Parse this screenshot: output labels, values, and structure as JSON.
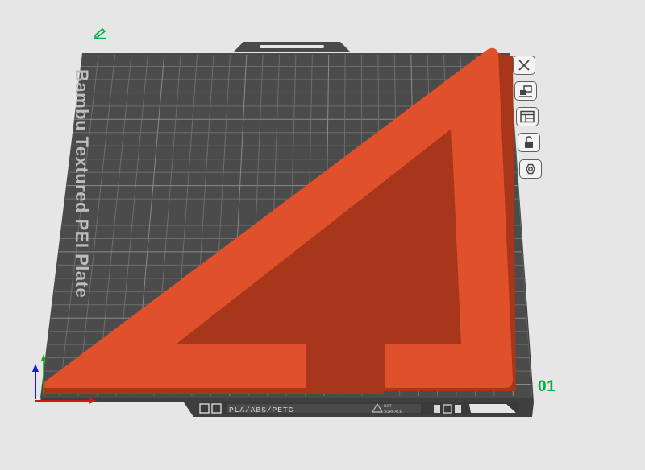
{
  "plate": {
    "name": "Bambu Textured PEI Plate",
    "number": "01",
    "filament_label": "PLA/ABS/PETG",
    "hot_surface_line1": "HOT",
    "hot_surface_line2": "SURFACE"
  },
  "colors": {
    "background": "#e6e6e6",
    "plate": "#4a4a4a",
    "model": "#e0502a",
    "accent": "#00ae42"
  },
  "toolbar": {
    "icons": [
      "close-icon",
      "arrange-icon",
      "layout-icon",
      "lock-icon",
      "settings-hex-icon"
    ]
  },
  "axes": [
    "x-axis",
    "y-axis",
    "z-axis"
  ],
  "edit_icon": "pencil-icon"
}
